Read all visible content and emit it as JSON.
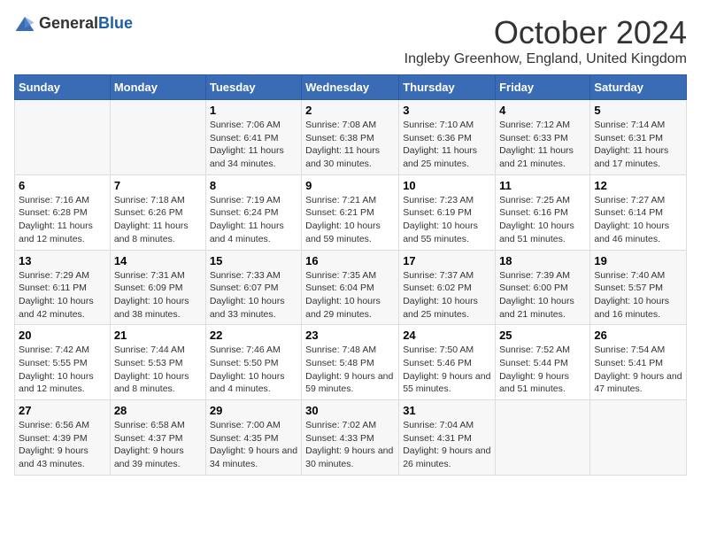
{
  "logo": {
    "text_general": "General",
    "text_blue": "Blue"
  },
  "title": {
    "month": "October 2024",
    "location": "Ingleby Greenhow, England, United Kingdom"
  },
  "headers": [
    "Sunday",
    "Monday",
    "Tuesday",
    "Wednesday",
    "Thursday",
    "Friday",
    "Saturday"
  ],
  "weeks": [
    [
      {
        "day": "",
        "info": ""
      },
      {
        "day": "",
        "info": ""
      },
      {
        "day": "1",
        "info": "Sunrise: 7:06 AM\nSunset: 6:41 PM\nDaylight: 11 hours and 34 minutes."
      },
      {
        "day": "2",
        "info": "Sunrise: 7:08 AM\nSunset: 6:38 PM\nDaylight: 11 hours and 30 minutes."
      },
      {
        "day": "3",
        "info": "Sunrise: 7:10 AM\nSunset: 6:36 PM\nDaylight: 11 hours and 25 minutes."
      },
      {
        "day": "4",
        "info": "Sunrise: 7:12 AM\nSunset: 6:33 PM\nDaylight: 11 hours and 21 minutes."
      },
      {
        "day": "5",
        "info": "Sunrise: 7:14 AM\nSunset: 6:31 PM\nDaylight: 11 hours and 17 minutes."
      }
    ],
    [
      {
        "day": "6",
        "info": "Sunrise: 7:16 AM\nSunset: 6:28 PM\nDaylight: 11 hours and 12 minutes."
      },
      {
        "day": "7",
        "info": "Sunrise: 7:18 AM\nSunset: 6:26 PM\nDaylight: 11 hours and 8 minutes."
      },
      {
        "day": "8",
        "info": "Sunrise: 7:19 AM\nSunset: 6:24 PM\nDaylight: 11 hours and 4 minutes."
      },
      {
        "day": "9",
        "info": "Sunrise: 7:21 AM\nSunset: 6:21 PM\nDaylight: 10 hours and 59 minutes."
      },
      {
        "day": "10",
        "info": "Sunrise: 7:23 AM\nSunset: 6:19 PM\nDaylight: 10 hours and 55 minutes."
      },
      {
        "day": "11",
        "info": "Sunrise: 7:25 AM\nSunset: 6:16 PM\nDaylight: 10 hours and 51 minutes."
      },
      {
        "day": "12",
        "info": "Sunrise: 7:27 AM\nSunset: 6:14 PM\nDaylight: 10 hours and 46 minutes."
      }
    ],
    [
      {
        "day": "13",
        "info": "Sunrise: 7:29 AM\nSunset: 6:11 PM\nDaylight: 10 hours and 42 minutes."
      },
      {
        "day": "14",
        "info": "Sunrise: 7:31 AM\nSunset: 6:09 PM\nDaylight: 10 hours and 38 minutes."
      },
      {
        "day": "15",
        "info": "Sunrise: 7:33 AM\nSunset: 6:07 PM\nDaylight: 10 hours and 33 minutes."
      },
      {
        "day": "16",
        "info": "Sunrise: 7:35 AM\nSunset: 6:04 PM\nDaylight: 10 hours and 29 minutes."
      },
      {
        "day": "17",
        "info": "Sunrise: 7:37 AM\nSunset: 6:02 PM\nDaylight: 10 hours and 25 minutes."
      },
      {
        "day": "18",
        "info": "Sunrise: 7:39 AM\nSunset: 6:00 PM\nDaylight: 10 hours and 21 minutes."
      },
      {
        "day": "19",
        "info": "Sunrise: 7:40 AM\nSunset: 5:57 PM\nDaylight: 10 hours and 16 minutes."
      }
    ],
    [
      {
        "day": "20",
        "info": "Sunrise: 7:42 AM\nSunset: 5:55 PM\nDaylight: 10 hours and 12 minutes."
      },
      {
        "day": "21",
        "info": "Sunrise: 7:44 AM\nSunset: 5:53 PM\nDaylight: 10 hours and 8 minutes."
      },
      {
        "day": "22",
        "info": "Sunrise: 7:46 AM\nSunset: 5:50 PM\nDaylight: 10 hours and 4 minutes."
      },
      {
        "day": "23",
        "info": "Sunrise: 7:48 AM\nSunset: 5:48 PM\nDaylight: 9 hours and 59 minutes."
      },
      {
        "day": "24",
        "info": "Sunrise: 7:50 AM\nSunset: 5:46 PM\nDaylight: 9 hours and 55 minutes."
      },
      {
        "day": "25",
        "info": "Sunrise: 7:52 AM\nSunset: 5:44 PM\nDaylight: 9 hours and 51 minutes."
      },
      {
        "day": "26",
        "info": "Sunrise: 7:54 AM\nSunset: 5:41 PM\nDaylight: 9 hours and 47 minutes."
      }
    ],
    [
      {
        "day": "27",
        "info": "Sunrise: 6:56 AM\nSunset: 4:39 PM\nDaylight: 9 hours and 43 minutes."
      },
      {
        "day": "28",
        "info": "Sunrise: 6:58 AM\nSunset: 4:37 PM\nDaylight: 9 hours and 39 minutes."
      },
      {
        "day": "29",
        "info": "Sunrise: 7:00 AM\nSunset: 4:35 PM\nDaylight: 9 hours and 34 minutes."
      },
      {
        "day": "30",
        "info": "Sunrise: 7:02 AM\nSunset: 4:33 PM\nDaylight: 9 hours and 30 minutes."
      },
      {
        "day": "31",
        "info": "Sunrise: 7:04 AM\nSunset: 4:31 PM\nDaylight: 9 hours and 26 minutes."
      },
      {
        "day": "",
        "info": ""
      },
      {
        "day": "",
        "info": ""
      }
    ]
  ]
}
